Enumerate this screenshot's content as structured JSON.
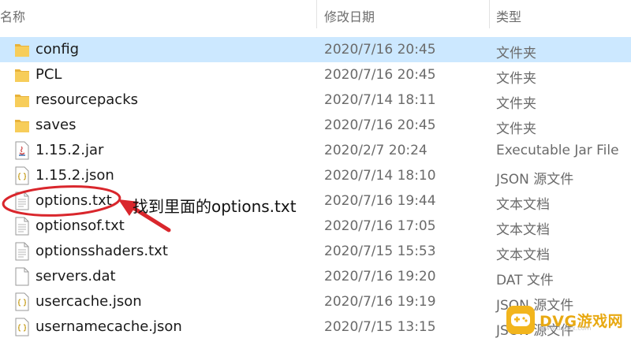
{
  "columns": {
    "name": "名称",
    "date": "修改日期",
    "type": "类型"
  },
  "files": [
    {
      "name": "config",
      "date": "2020/7/16 20:45",
      "type": "文件夹",
      "icon": "folder-icon"
    },
    {
      "name": "PCL",
      "date": "2020/7/16 20:45",
      "type": "文件夹",
      "icon": "folder-icon"
    },
    {
      "name": "resourcepacks",
      "date": "2020/7/14 18:11",
      "type": "文件夹",
      "icon": "folder-icon"
    },
    {
      "name": "saves",
      "date": "2020/7/16 20:45",
      "type": "文件夹",
      "icon": "folder-icon"
    },
    {
      "name": "1.15.2.jar",
      "date": "2020/2/7 20:24",
      "type": "Executable Jar File",
      "icon": "java-jar-icon"
    },
    {
      "name": "1.15.2.json",
      "date": "2020/7/14 18:10",
      "type": "JSON 源文件",
      "icon": "json-file-icon"
    },
    {
      "name": "options.txt",
      "date": "2020/7/16 19:44",
      "type": "文本文档",
      "icon": "text-file-icon"
    },
    {
      "name": "optionsof.txt",
      "date": "2020/7/16 17:05",
      "type": "文本文档",
      "icon": "text-file-icon"
    },
    {
      "name": "optionsshaders.txt",
      "date": "2020/7/15 15:53",
      "type": "文本文档",
      "icon": "text-file-icon"
    },
    {
      "name": "servers.dat",
      "date": "2020/7/16 19:20",
      "type": "DAT 文件",
      "icon": "dat-file-icon"
    },
    {
      "name": "usercache.json",
      "date": "2020/7/16 19:19",
      "type": "JSON 源文件",
      "icon": "json-file-icon"
    },
    {
      "name": "usernamecache.json",
      "date": "2020/7/15 13:15",
      "type": "JSON 源文件",
      "icon": "json-file-icon"
    }
  ],
  "annotation": {
    "text": "找到里面的options.txt",
    "color": "#d9262c"
  },
  "watermark": {
    "text": "DVG游戏网",
    "url": "www.dvgxx.com",
    "color": "#f2b51d"
  },
  "colors": {
    "selected_row": "#cce8ff",
    "folder": "#f5c242"
  }
}
